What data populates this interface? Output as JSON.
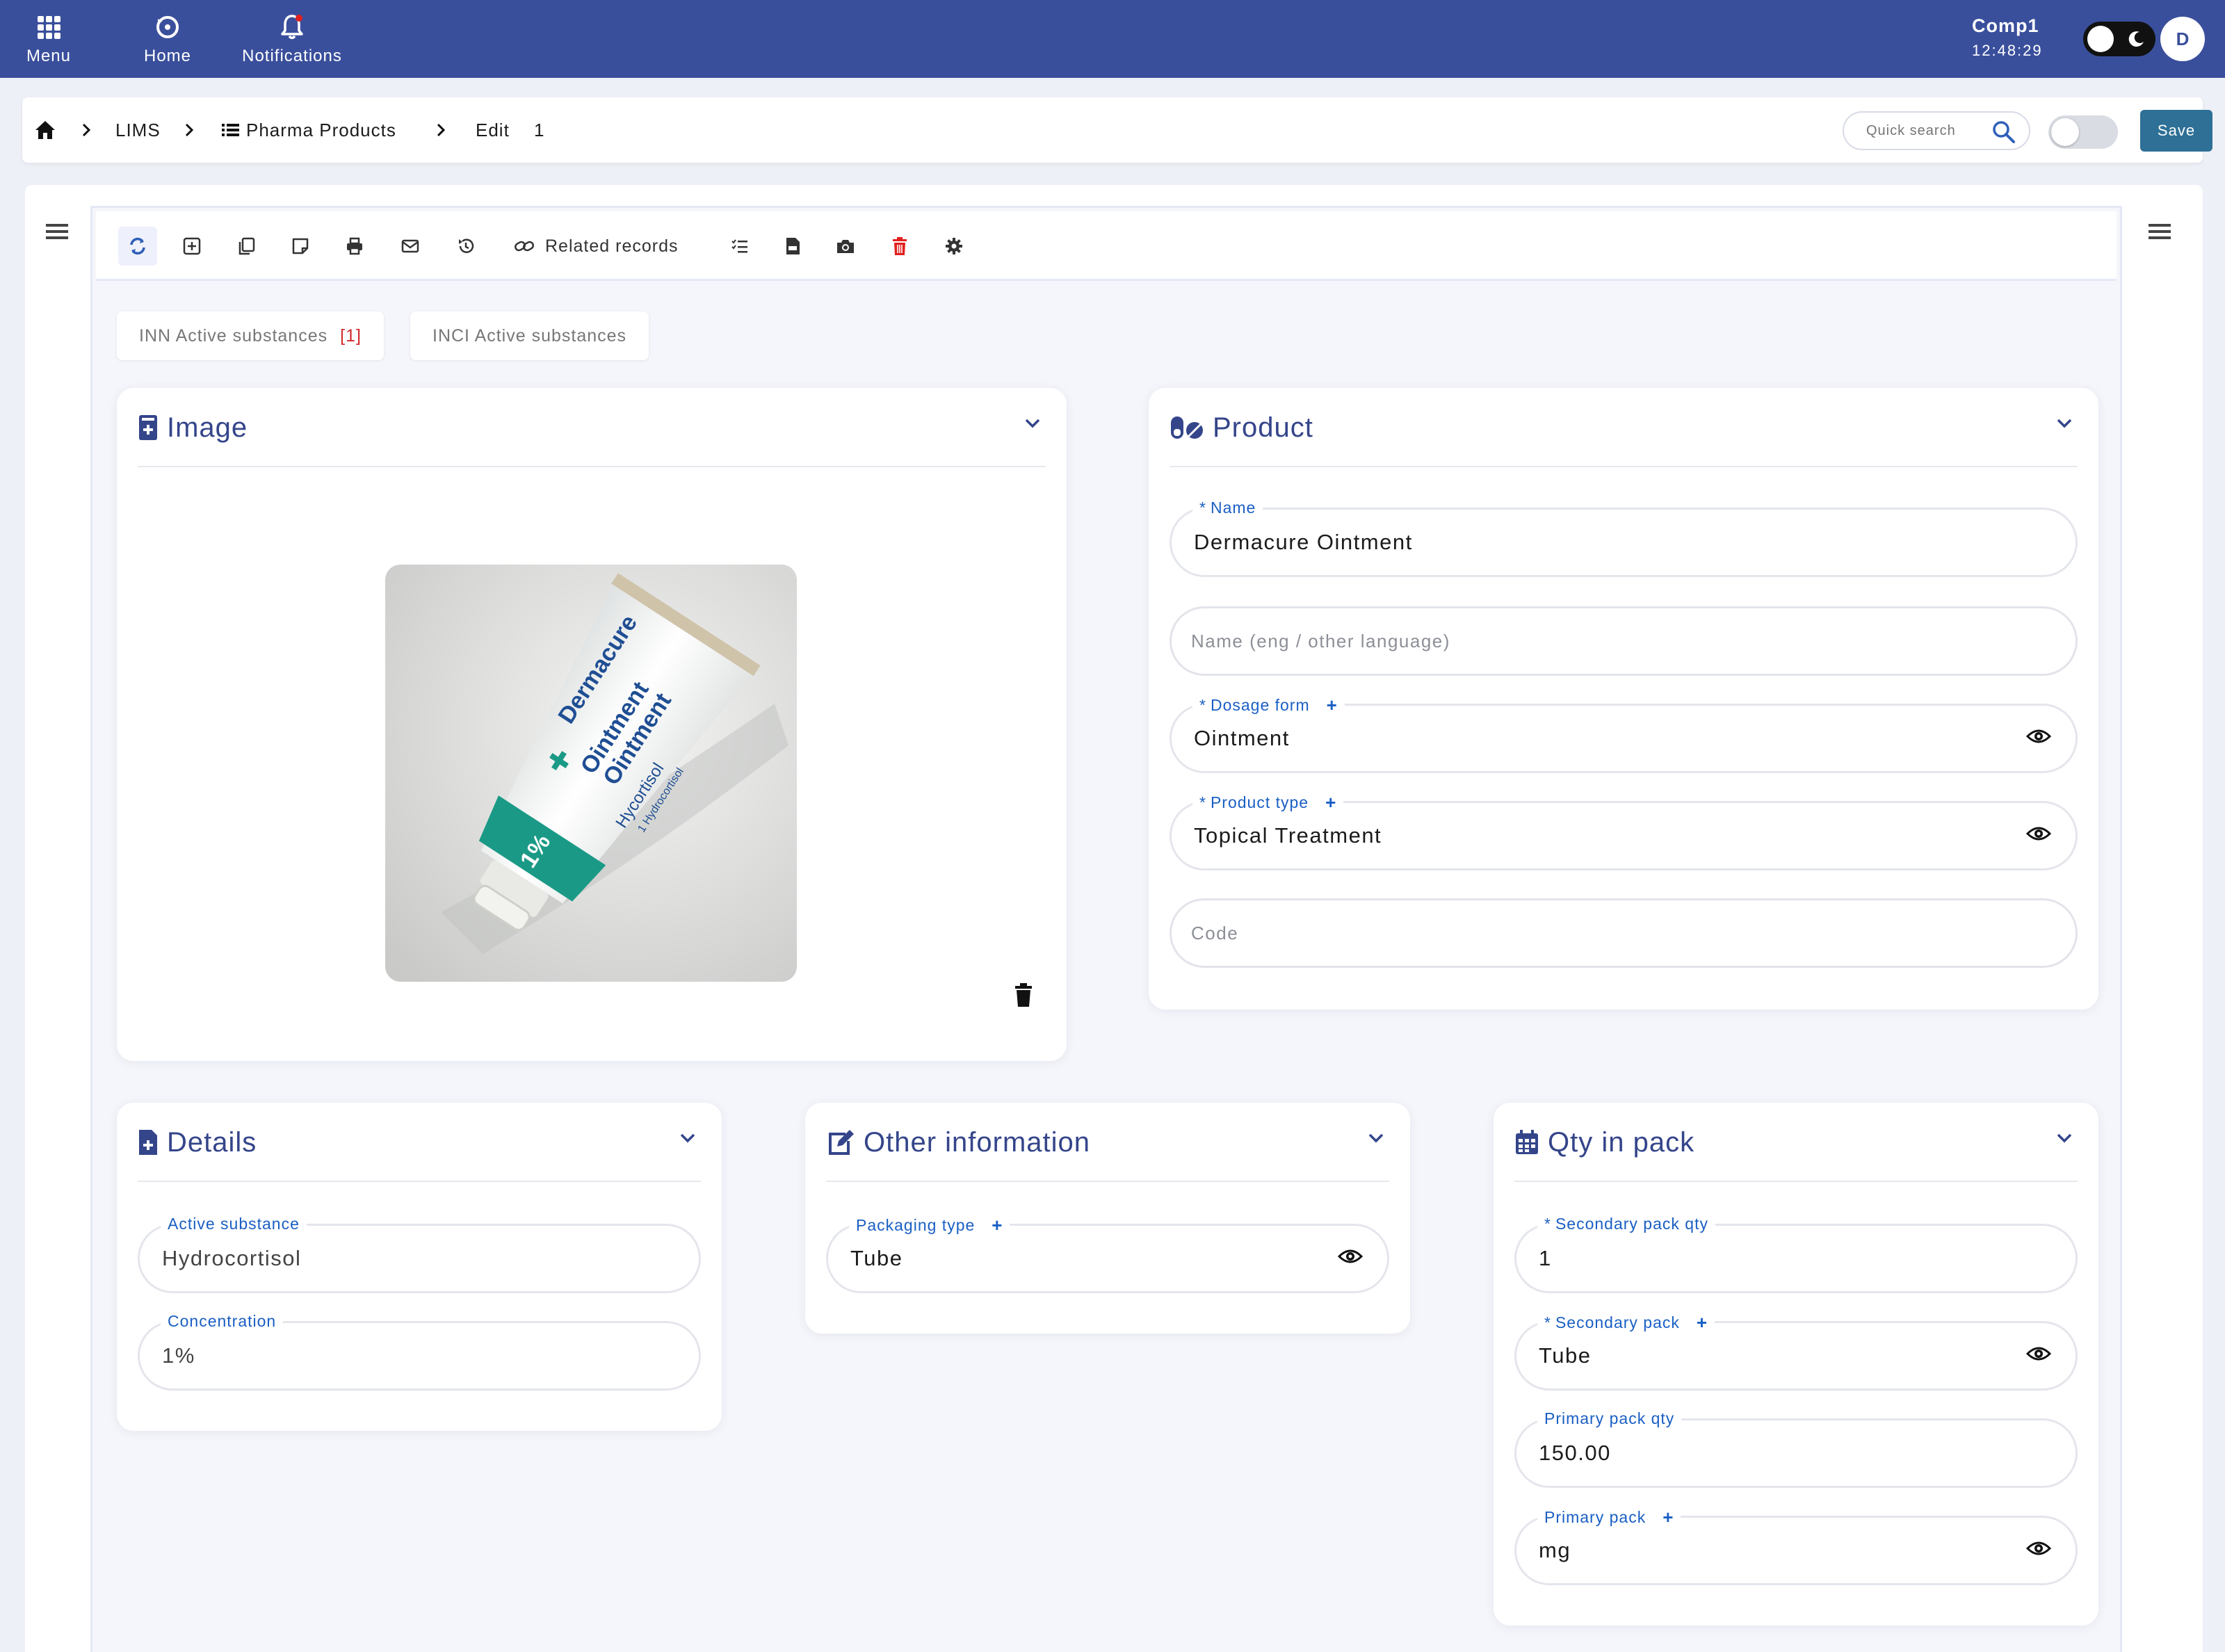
{
  "topbar": {
    "menu_label": "Menu",
    "home_label": "Home",
    "notifications_label": "Notifications",
    "company": "Comp1",
    "time": "12:48:29",
    "avatar_initial": "D"
  },
  "breadcrumb": {
    "lims": "LIMS",
    "pharma_products": "Pharma Products",
    "edit": "Edit",
    "record_id": "1"
  },
  "search": {
    "placeholder": "Quick search"
  },
  "save_label": "Save",
  "toolbar": {
    "related_records_label": "Related records"
  },
  "tabs": [
    {
      "label": "INN Active substances",
      "count": "[1]"
    },
    {
      "label": "INCI Active substances"
    }
  ],
  "image_card": {
    "title": "Image",
    "tube_text": {
      "brand": "Dermacure",
      "line2": "Ointment",
      "line3": "Ointment",
      "ingredient": "Hycortisol",
      "sub": "1 Hydrocortisol",
      "percent": "1%"
    }
  },
  "product_card": {
    "title": "Product",
    "name": {
      "label": "Name",
      "value": "Dermacure Ointment"
    },
    "name_other": {
      "placeholder": "Name (eng / other language)"
    },
    "dosage_form": {
      "label": "Dosage form",
      "value": "Ointment"
    },
    "product_type": {
      "label": "Product type",
      "value": "Topical Treatment"
    },
    "code": {
      "placeholder": "Code"
    }
  },
  "details_card": {
    "title": "Details",
    "active_substance": {
      "label": "Active substance",
      "value": "Hydrocortisol"
    },
    "concentration": {
      "label": "Concentration",
      "value": "1%"
    }
  },
  "other_card": {
    "title": "Other information",
    "packaging_type": {
      "label": "Packaging type",
      "value": "Tube"
    }
  },
  "qty_card": {
    "title": "Qty in pack",
    "secondary_pack_qty": {
      "label": "Secondary pack qty",
      "value": "1"
    },
    "secondary_pack": {
      "label": "Secondary pack",
      "value": "Tube"
    },
    "primary_pack_qty": {
      "label": "Primary pack qty",
      "value": "150.00"
    },
    "primary_pack": {
      "label": "Primary pack",
      "value": "mg"
    }
  },
  "colors": {
    "topbar": "#3a4f9c",
    "accent_title": "#34458a",
    "label_blue": "#1a5fc4",
    "save_button": "#2e7096",
    "delete_red": "#e0201e",
    "tab_count_red": "#d12b2b"
  }
}
